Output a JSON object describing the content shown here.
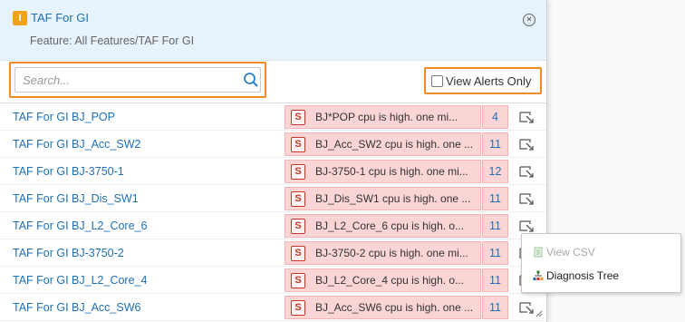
{
  "header": {
    "icon_letter": "I",
    "title": "TAF For GI",
    "subtitle": "Feature: All Features/TAF For GI",
    "close_icon": "close-icon"
  },
  "toolbar": {
    "search_placeholder": "Search...",
    "view_alerts_label": "View Alerts Only",
    "view_alerts_checked": false
  },
  "rows": [
    {
      "name": "TAF For GI BJ_POP",
      "severity": "S",
      "alert": "BJ*POP cpu is high. one mi...",
      "count": "4"
    },
    {
      "name": "TAF For GI BJ_Acc_SW2",
      "severity": "S",
      "alert": "BJ_Acc_SW2 cpu is high. one ...",
      "count": "11"
    },
    {
      "name": "TAF For GI BJ-3750-1",
      "severity": "S",
      "alert": "BJ-3750-1 cpu is high. one mi...",
      "count": "12"
    },
    {
      "name": "TAF For GI BJ_Dis_SW1",
      "severity": "S",
      "alert": "BJ_Dis_SW1 cpu is high. one ...",
      "count": "11"
    },
    {
      "name": "TAF For GI BJ_L2_Core_6",
      "severity": "S",
      "alert": "BJ_L2_Core_6 cpu is high. o...",
      "count": "11"
    },
    {
      "name": "TAF For GI BJ-3750-2",
      "severity": "S",
      "alert": "BJ-3750-2 cpu is high. one mi...",
      "count": "11"
    },
    {
      "name": "TAF For GI BJ_L2_Core_4",
      "severity": "S",
      "alert": "BJ_L2_Core_4 cpu is high. o...",
      "count": "11"
    },
    {
      "name": "TAF For GI BJ_Acc_SW6",
      "severity": "S",
      "alert": "BJ_Acc_SW6 cpu is high. one ...",
      "count": "11"
    }
  ],
  "context_menu": {
    "view_csv": "View CSV",
    "diagnosis_tree": "Diagnosis Tree"
  },
  "colors": {
    "header_bg": "#e6f3fc",
    "highlight_border": "#f08a24",
    "link": "#1e6fb8",
    "alert_bg": "#fbd5d5"
  }
}
